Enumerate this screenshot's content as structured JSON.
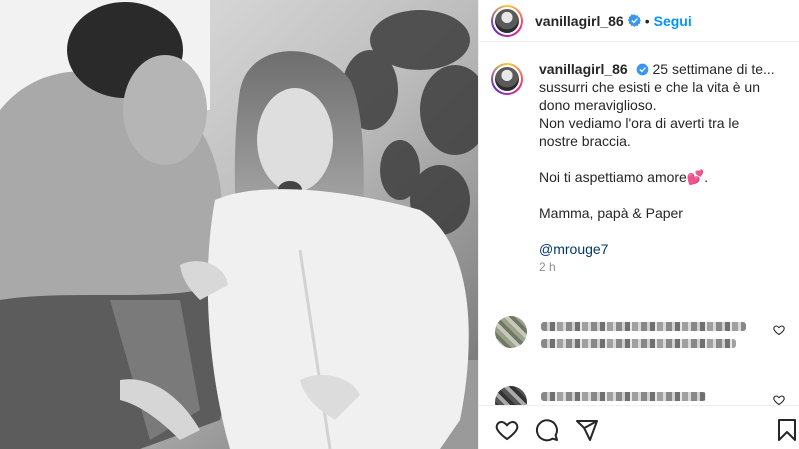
{
  "post": {
    "username": "vanillagirl_86",
    "follow_label": "Segui",
    "dot": "•",
    "photo_alt": ""
  },
  "caption": {
    "username": "vanillagirl_86",
    "line1": "25 settimane di te...",
    "line2": "sussurri che esisti e che la vita è un",
    "line3": "dono meraviglioso.",
    "line4": "Non vediamo l'ora di averti tra le",
    "line5": "nostre braccia.",
    "line6": "Noi ti aspettiamo amore💕.",
    "line7": "Mamma, papà & Paper",
    "mention": "@mrouge7",
    "time": "2 h"
  },
  "icons": {
    "verified": "verified-badge-icon",
    "like": "heart-icon",
    "comment": "comment-icon",
    "share": "share-icon",
    "save": "bookmark-icon"
  },
  "colors": {
    "accent": "#0095f6",
    "verified": "#3897f0",
    "mention": "#00376b",
    "muted": "#8e8e8e"
  }
}
